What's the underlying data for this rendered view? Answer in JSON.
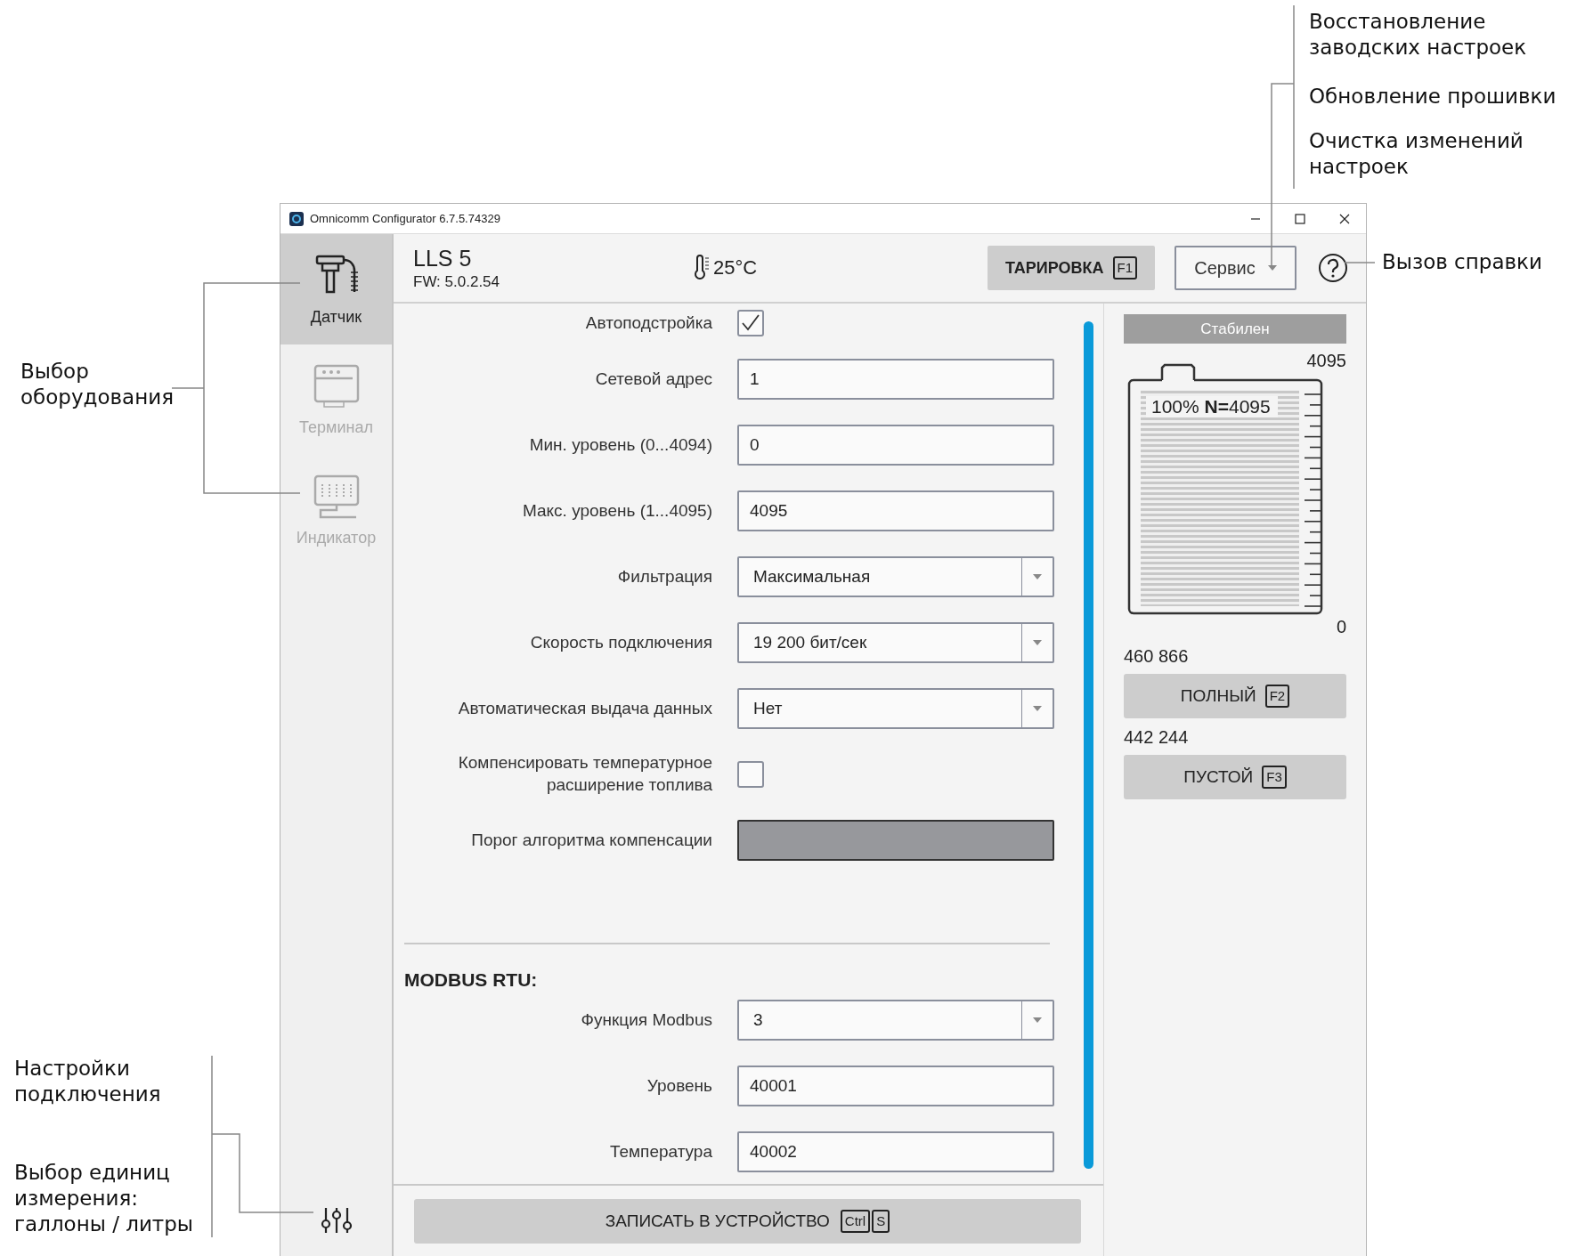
{
  "window": {
    "title": "Omnicomm Configurator 6.7.5.74329"
  },
  "sidebar": {
    "items": [
      {
        "kind": "sensor",
        "label": "Датчик",
        "selected": true
      },
      {
        "kind": "terminal",
        "label": "Терминал",
        "selected": false
      },
      {
        "kind": "indicator",
        "label": "Индикатор",
        "selected": false
      }
    ]
  },
  "header": {
    "device": "LLS 5",
    "firmware": "FW: 5.0.2.54",
    "temperature": "25°C",
    "calibrate_button": {
      "label": "ТАРИРОВКА",
      "key": "F1"
    },
    "service_button": "Сервис"
  },
  "settings": [
    {
      "kind": "checkbox",
      "label": "Автоподстройка",
      "checked": true
    },
    {
      "kind": "text",
      "label": "Сетевой адрес",
      "value": "1",
      "disabled": false
    },
    {
      "kind": "text",
      "label": "Мин. уровень (0...4094)",
      "value": "0",
      "disabled": false
    },
    {
      "kind": "text",
      "label": "Макс. уровень (1...4095)",
      "value": "4095",
      "disabled": false
    },
    {
      "kind": "select",
      "label": "Фильтрация",
      "value": "Максимальная"
    },
    {
      "kind": "select",
      "label": "Скорость подключения",
      "value": "19 200 бит/сек"
    },
    {
      "kind": "select",
      "label": "Автоматическая выдача данных",
      "value": "Нет"
    },
    {
      "kind": "checkbox",
      "label": "Компенсировать температурное\nрасширение топлива",
      "checked": false
    },
    {
      "kind": "text",
      "label": "Порог алгоритма компенсации",
      "disabled": true
    }
  ],
  "modbus": {
    "title": "MODBUS RTU:",
    "settings": [
      {
        "kind": "select",
        "label": "Функция Modbus",
        "value": "3"
      },
      {
        "kind": "text",
        "label": "Уровень",
        "value": "40001",
        "disabled": false
      },
      {
        "kind": "text",
        "label": "Температура",
        "value": "40002",
        "disabled": false
      }
    ]
  },
  "write_button": {
    "label": "ЗАПИСАТЬ В УСТРОЙСТВО",
    "keys": [
      "Ctrl",
      "S"
    ]
  },
  "tank": {
    "status": "Стабилен",
    "max": "4095",
    "reading": "100% **N=**4095",
    "min": "0",
    "level": 1,
    "full_value": "460 866",
    "full_button": {
      "label": "ПОЛНЫЙ",
      "key": "F2"
    },
    "empty_value": "442 244",
    "empty_button": {
      "label": "ПУСТОЙ",
      "key": "F3"
    }
  },
  "annotations": [
    {
      "text": "Восстановление\nзаводских настроек"
    },
    {
      "text": "Обновление прошивки"
    },
    {
      "text": "Очистка изменений\nнастроек"
    },
    {
      "text": "Вызов справки"
    },
    {
      "text": "Выбор\nоборудования"
    },
    {
      "text": "Настройки\nподключения"
    },
    {
      "text": "Выбор единиц\nизмерения:\nгаллоны / литры"
    }
  ]
}
